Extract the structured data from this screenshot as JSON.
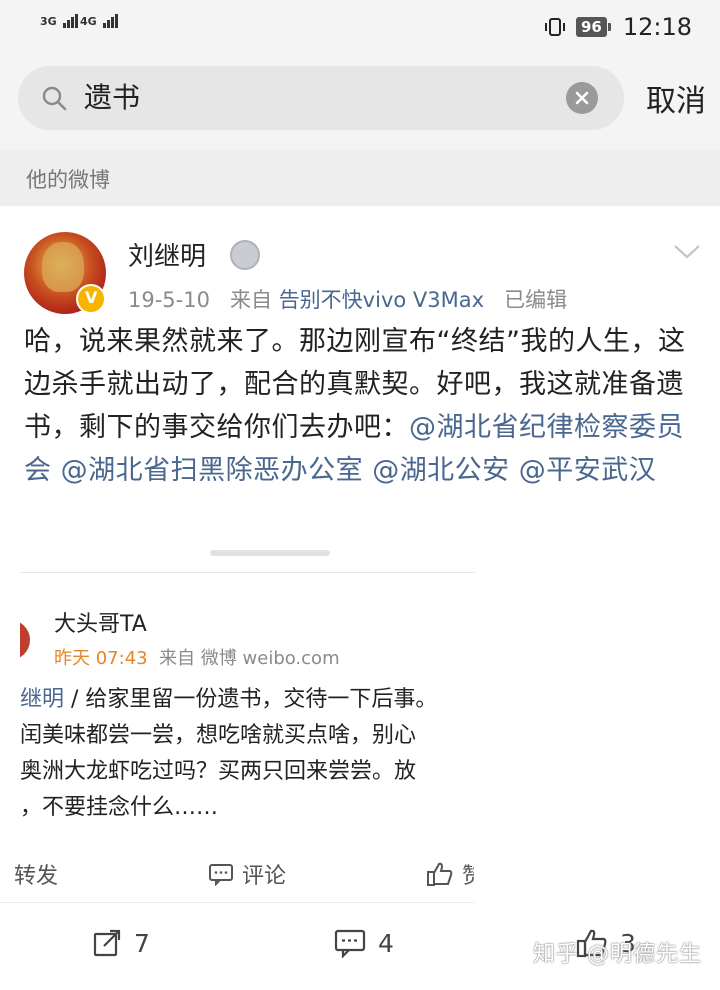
{
  "status_bar": {
    "signal_1": "3G",
    "signal_2": "4G",
    "battery": "96",
    "time": "12:18"
  },
  "search": {
    "query": "遗书",
    "cancel_label": "取消"
  },
  "section": {
    "title": "他的微博"
  },
  "post": {
    "username": "刘继明",
    "date": "19-5-10",
    "source_prefix": "来自",
    "source": "告别不快vivo V3Max",
    "edited": "已编辑",
    "text": "哈，说来果然就来了。那边刚宣布“终结”我的人生，这边杀手就出动了，配合的真默契。好吧，我这就准备遗书，剩下的事交给你们去办吧：",
    "mentions": [
      "@湖北省纪律检察委员会",
      "@湖北省扫黑除恶办公室",
      "@湖北公安",
      "@平安武汉"
    ],
    "embedded": {
      "name": "大头哥TA",
      "time": "昨天 07:43",
      "source_prefix": "来自",
      "source": "微博 weibo.com",
      "line1_mention": "继明",
      "line1": " / 给家里留一份遗书，交待一下后事。",
      "line2": "闰美味都尝一尝，想吃啥就买点啥，别心",
      "line3": "奥洲大龙虾吃过吗？买两只回来尝尝。放",
      "line4": "，不要挂念什么……",
      "repost_label": "转发",
      "comment_label": "评论",
      "like_fragment": "赞"
    },
    "actions": {
      "repost_count": "7",
      "comment_count": "4",
      "like_count": "3"
    }
  },
  "watermark": "知乎 @明德先生",
  "colors": {
    "link_blue": "#49678f",
    "orange_time": "#e5852b",
    "verified_gold": "#f7b500"
  }
}
